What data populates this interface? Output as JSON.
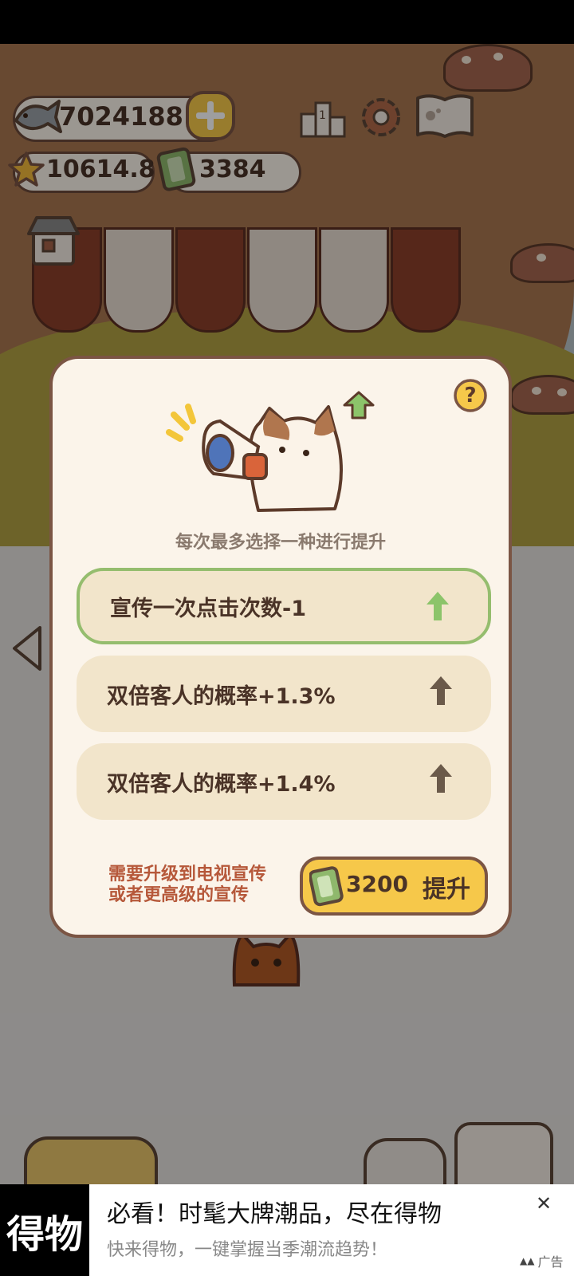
{
  "hud": {
    "fish_count": "7024188",
    "star_score": "10614.8",
    "ticket_count": "3384",
    "icons": [
      "fish-icon",
      "add-plus-icon",
      "star-icon",
      "ticket-icon",
      "ranking-podium-icon",
      "settings-gear-icon",
      "paw-book-icon",
      "shop-house-icon",
      "back-arrow-icon"
    ]
  },
  "dialog": {
    "help_symbol": "?",
    "subtitle": "每次最多选择一种进行提升",
    "options": [
      {
        "label": "宣传一次点击次数-1",
        "selected": true
      },
      {
        "label": "双倍客人的概率+1.3%",
        "selected": false
      },
      {
        "label": "双倍客人的概率+1.4%",
        "selected": false
      }
    ],
    "requirement_line1": "需要升级到电视宣传",
    "requirement_line2": "或者更高级的宣传",
    "upgrade_cost": "3200",
    "upgrade_label": "提升"
  },
  "ad": {
    "logo_text": "得物",
    "title": "必看！时髦大牌潮品，尽在得物",
    "subtitle": "快来得物，一键掌握当季潮流趋势！",
    "tag": "广告",
    "close_symbol": "✕"
  },
  "colors": {
    "panel_bg": "#fbf4ea",
    "panel_border": "#7b5544",
    "option_bg": "#f2e5cb",
    "selected_border": "#95bd6e",
    "selected_arrow": "#8cc46a",
    "arrow_gray": "#6b5a4a",
    "button_yellow": "#f6c84a",
    "requirement_text": "#b6583a",
    "text_dark": "#4a3327"
  }
}
